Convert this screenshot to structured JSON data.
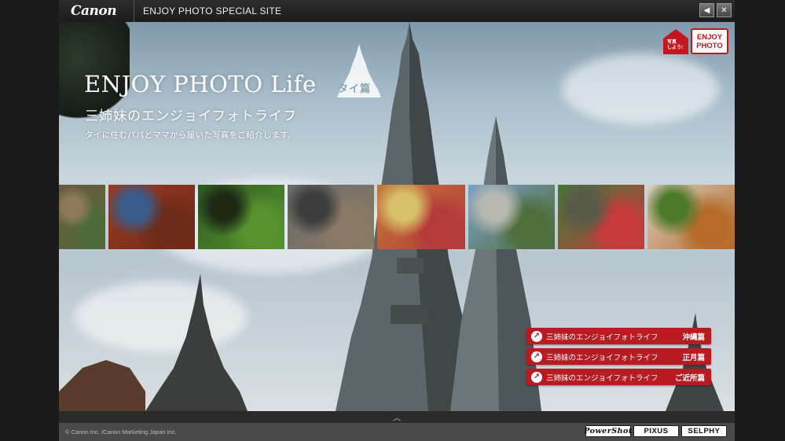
{
  "topbar": {
    "brand": "Canon",
    "site_title": "ENJOY PHOTO SPECIAL SITE",
    "buttons": [
      {
        "icon": "speaker-icon",
        "glyph": "◀"
      },
      {
        "icon": "close-icon",
        "glyph": "✕"
      }
    ]
  },
  "hero": {
    "title": "ENJOY PHOTO Life",
    "badge_text": "タイ篇",
    "subtitle": "三姉妹のエンジョイフォトライフ",
    "description": "タイに住むパパとママから届いた写真をご紹介します。",
    "logo": {
      "small_text_1": "写真",
      "small_text_2": "しよう!",
      "line1": "ENJOY",
      "line2": "PHOTO"
    }
  },
  "thumbnails": [
    {
      "name": "market-stall-thumb",
      "colors": [
        "#6b5a3c",
        "#4f6b3a",
        "#8c7a5a"
      ]
    },
    {
      "name": "chili-market-thumb",
      "colors": [
        "#9a3b20",
        "#6e2a18",
        "#3a5c8a"
      ]
    },
    {
      "name": "green-vegetables-thumb",
      "colors": [
        "#2e5b22",
        "#58932f",
        "#1e2a16"
      ]
    },
    {
      "name": "street-market-thumb",
      "colors": [
        "#6b6b6b",
        "#8a7a66",
        "#3b3b3b"
      ]
    },
    {
      "name": "colorful-snacks-thumb",
      "colors": [
        "#c2783a",
        "#b53a3a",
        "#d8c06a"
      ]
    },
    {
      "name": "city-street-thumb",
      "colors": [
        "#7ba0c8",
        "#4e6e3a",
        "#b8b8b0"
      ]
    },
    {
      "name": "fruit-cart-thumb",
      "colors": [
        "#3f7a3a",
        "#c73a3a",
        "#5a5a4a"
      ]
    },
    {
      "name": "thai-food-thumb",
      "colors": [
        "#d6cfc0",
        "#b56a2a",
        "#4d7a2a"
      ]
    }
  ],
  "links": [
    {
      "label": "三姉妹のエンジョイフォトライフ",
      "tag": "沖縄篇"
    },
    {
      "label": "三姉妹のエンジョイフォトライフ",
      "tag": "正月篇"
    },
    {
      "label": "三姉妹のエンジョイフォトライフ",
      "tag": "ご近所篇"
    }
  ],
  "collapse_glyph": "︿",
  "footer": {
    "copyright": "© Canon Inc. /Canon Marketing Japan Inc.",
    "products": [
      "PowerShot",
      "PIXUS",
      "SELPHY"
    ]
  },
  "colors": {
    "accent_red": "#b81c22",
    "logo_red": "#c5151f"
  }
}
